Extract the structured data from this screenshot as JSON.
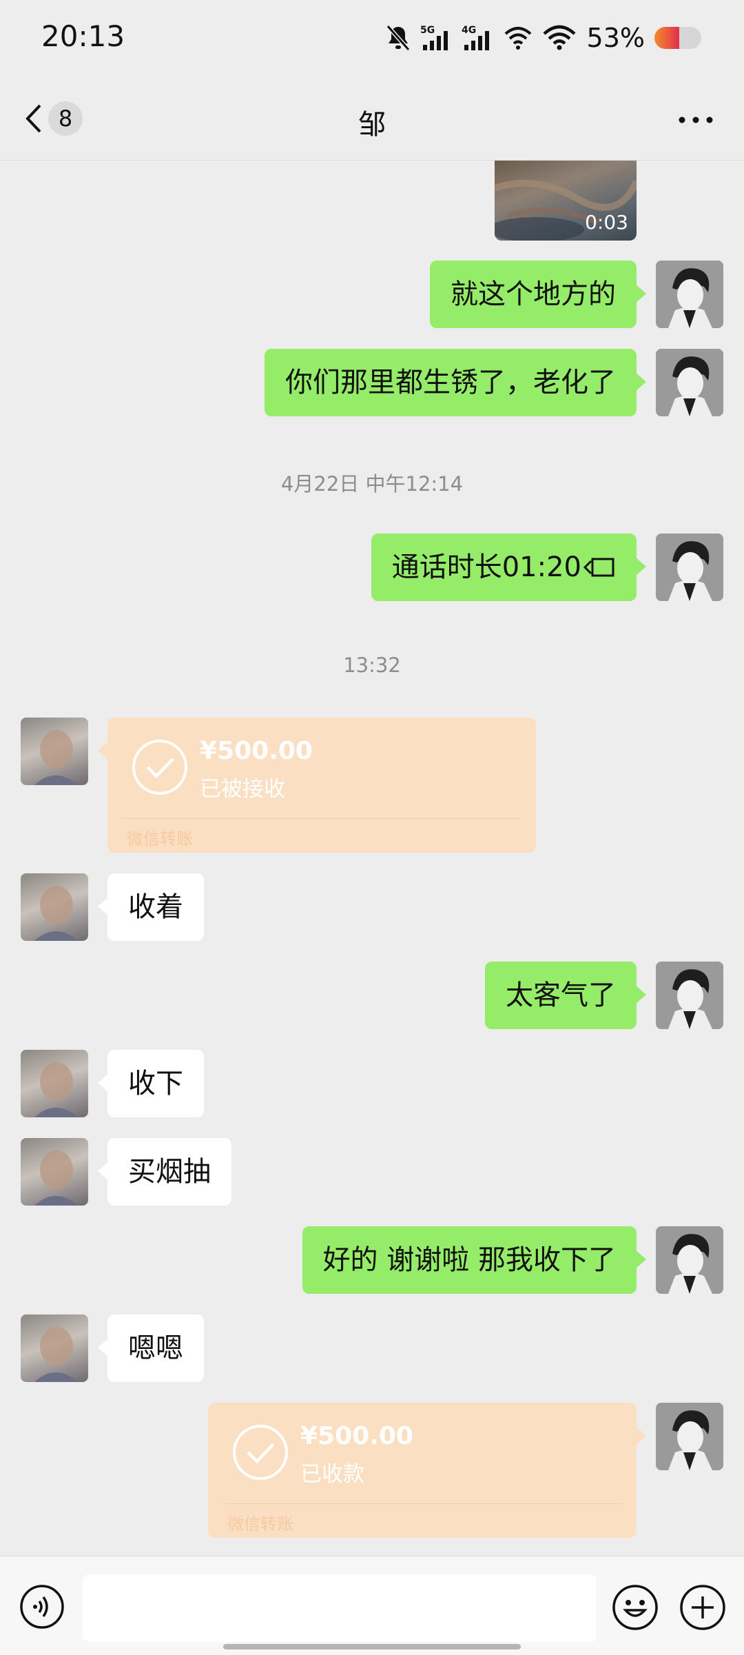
{
  "status_bar": {
    "time": "20:13",
    "net1": "5G",
    "net2": "4G",
    "battery_pct": "53%",
    "icons": [
      "mute-bell-icon",
      "signal-5g-icon",
      "signal-4g-icon",
      "wifi-arrows-icon",
      "wifi-icon",
      "battery-icon"
    ]
  },
  "header": {
    "unread_count": "8",
    "title": "邹"
  },
  "chat": {
    "video": {
      "duration": "0:03"
    },
    "msg1": "就这个地方的",
    "msg2": "你们那里都生锈了，老化了",
    "ts1": "4月22日 中午12:14",
    "call": "通话时长01:20",
    "ts2": "13:32",
    "transfer_in": {
      "amount": "¥500.00",
      "status": "已被接收",
      "label": "微信转账"
    },
    "msg3": "收着",
    "msg4": "太客气了",
    "msg5": "收下",
    "msg6": "买烟抽",
    "msg7": "好的 谢谢啦 那我收下了",
    "msg8": "嗯嗯",
    "transfer_out": {
      "amount": "¥500.00",
      "status": "已收款",
      "label": "微信转账"
    }
  },
  "bottom_bar": {
    "input_value": "",
    "icons": [
      "voice-icon",
      "emoji-icon",
      "plus-icon"
    ]
  },
  "colors": {
    "outgoing_bubble": "#95ec69",
    "incoming_bubble": "#ffffff",
    "transfer_card": "#fbdfc2",
    "background": "#ededed"
  }
}
